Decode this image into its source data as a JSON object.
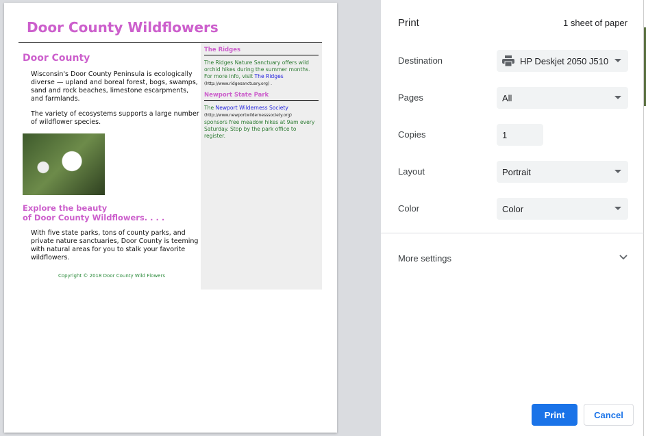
{
  "document": {
    "title": "Door County Wildflowers",
    "section1_heading": "Door County",
    "para1": "Wisconsin's Door County Peninsula is ecologically diverse — upland and boreal forest, bogs, swamps, sand and rock beaches, limestone escarpments, and farmlands.",
    "para2": "The variety of ecosystems supports a large number of wildflower species.",
    "section2_heading_line1": "Explore the beauty",
    "section2_heading_line2": "of Door County Wildflowers. . . .",
    "para3": "With five state parks, tons of county parks, and private nature sanctuaries, Door County is teeming with natural areas for you to stalk your favorite wildflowers.",
    "copyright": "Copyright © 2018 Door County Wild Flowers",
    "sidebar": {
      "ridges_heading": "The Ridges",
      "ridges_text": "The Ridges Nature Sanctuary offers wild orchid hikes during the summer months. For more info, visit ",
      "ridges_link": "The Ridges",
      "ridges_url": "(http://www.ridgesanctuary.org)",
      "ridges_end": " .",
      "newport_heading": "Newport State Park",
      "newport_pre": "The ",
      "newport_link": "Newport Wilderness Society",
      "newport_url": "(http://www.newportwildernesssociety.org)",
      "newport_text": "sponsors free meadow hikes at 9am every Saturday. Stop by the park office to register."
    }
  },
  "print": {
    "title": "Print",
    "sheets": "1 sheet of paper",
    "destination_label": "Destination",
    "destination_value": "HP Deskjet 2050 J510",
    "pages_label": "Pages",
    "pages_value": "All",
    "copies_label": "Copies",
    "copies_value": "1",
    "layout_label": "Layout",
    "layout_value": "Portrait",
    "color_label": "Color",
    "color_value": "Color",
    "more_settings": "More settings",
    "print_button": "Print",
    "cancel_button": "Cancel",
    "accent": "#1a73e8"
  }
}
